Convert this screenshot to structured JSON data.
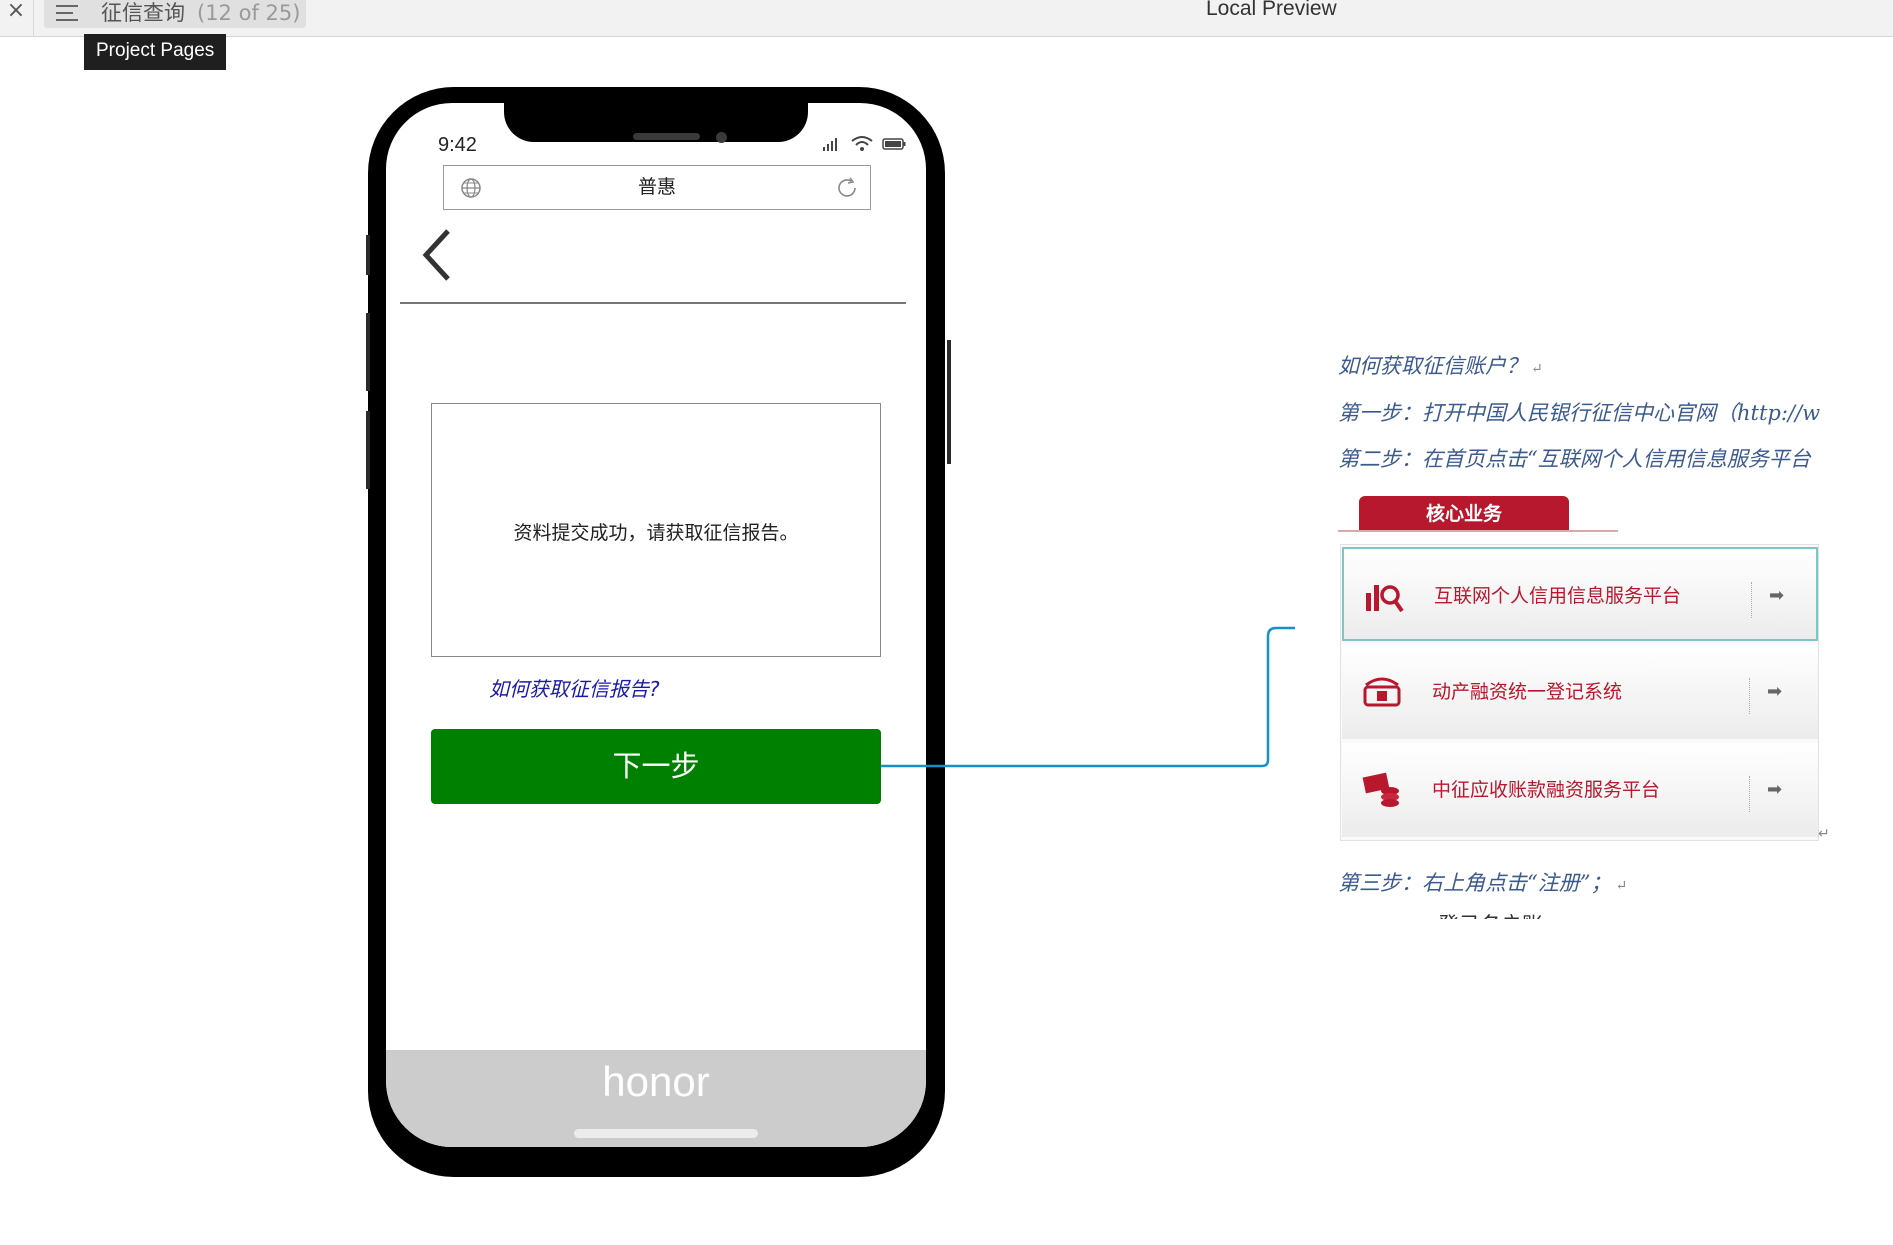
{
  "topbar": {
    "close_glyph": "×",
    "page_name": "征信查询",
    "page_count": "(12 of 25)",
    "preview_title": "Local Preview",
    "tooltip": "Project Pages"
  },
  "phone": {
    "time": "9:42",
    "url_text": "普惠",
    "message": "资料提交成功，请获取征信报告。",
    "help_link": "如何获取征信报告?",
    "next_button": "下一步",
    "brand": "honor"
  },
  "doc": {
    "line1": "如何获取征信账户？",
    "line2": "第一步：打开中国人民银行征信中心官网（http://w",
    "line3": "第二步：在首页点击“互联网个人信用信息服务平台",
    "core_tab": "核心业务",
    "services": [
      "互联网个人信用信息服务平台",
      "动产融资统一登记系统",
      "中征应收账款融资服务平台"
    ],
    "line4": "第三步：右上角点击“注册”；",
    "line5_partial": "登录名户账"
  },
  "colors": {
    "next_button": "#008000",
    "link": "#1a1aaa",
    "doc_text": "#3c5a8e",
    "brand_red": "#b8182d",
    "connector": "#1591c8"
  }
}
